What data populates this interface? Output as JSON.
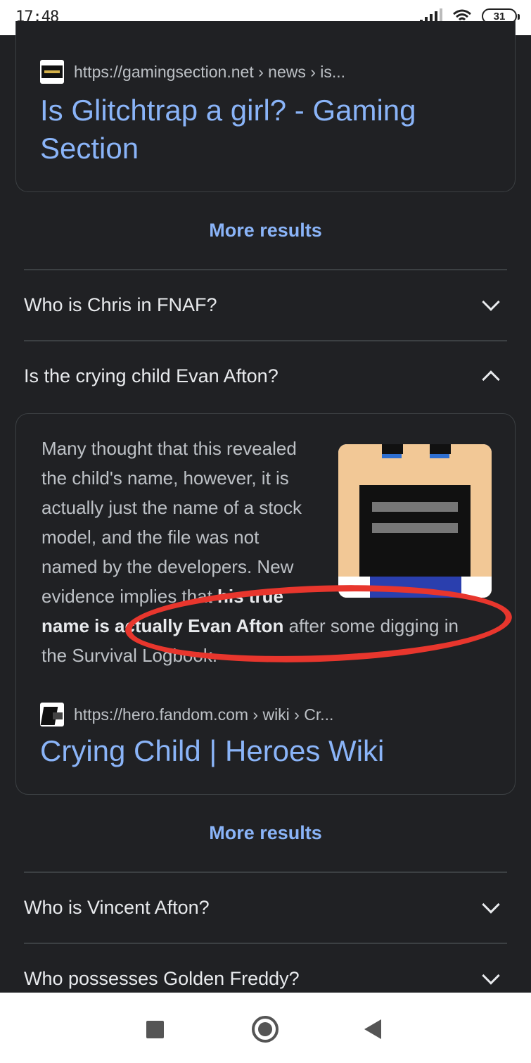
{
  "status_bar": {
    "time": "17:48",
    "battery": "31"
  },
  "top_result": {
    "favicon": "gamingsection-favicon",
    "url": "https://gamingsection.net › news › is...",
    "title_line1": "Is Glitchtrap a girl? - Gaming",
    "title_line2": "Section"
  },
  "more_results_1": "More results",
  "questions": {
    "chris": "Who is Chris in FNAF?",
    "crying_child": "Is the crying child Evan Afton?",
    "vincent": "Who is Vincent Afton?",
    "golden_freddy": "Who possesses Golden Freddy?"
  },
  "answer": {
    "text_before": "Many thought that this revealed the child's name, however, it is actually just the name of a stock model, and the file was not named by the developers. New evidence implies that ",
    "text_bold": "his true name is actually Evan Afton",
    "text_after": " after some digging in the Survival Logbook.",
    "image": "crying-child-pixel-thumbnail",
    "annotation_color": "#e8362d",
    "source_url": "https://hero.fandom.com › wiki › Cr...",
    "source_title": "Crying Child | Heroes Wiki"
  },
  "more_results_2": "More results",
  "colors": {
    "background": "#202124",
    "link": "#8ab4f8",
    "text": "#e8eaed",
    "annotation": "#e8362d"
  },
  "nav_icons": [
    "recents-square-icon",
    "home-circle-icon",
    "back-triangle-icon"
  ]
}
